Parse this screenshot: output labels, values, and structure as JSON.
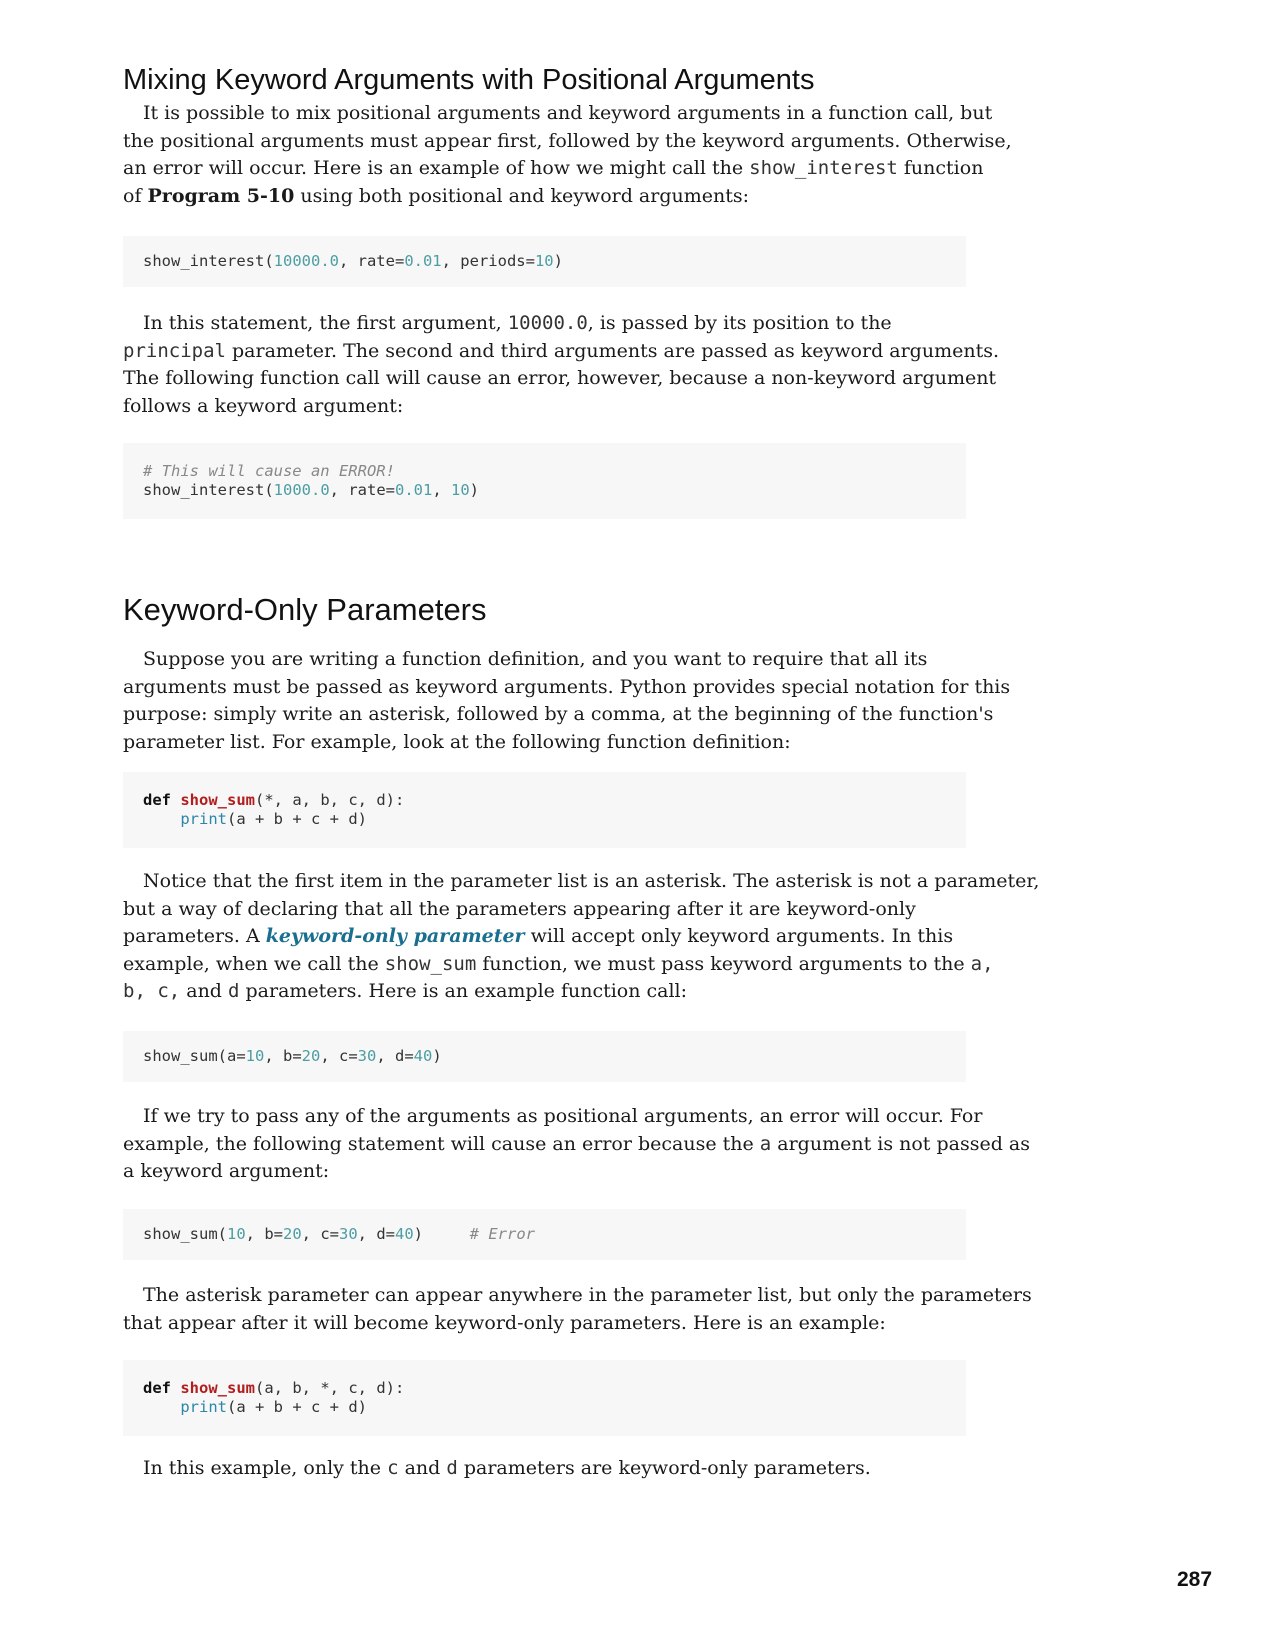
{
  "section1": {
    "heading": "Mixing Keyword Arguments with Positional Arguments",
    "p1": {
      "l1": "It is possible to mix positional arguments and keyword arguments in a function call, but",
      "l2": "the positional arguments must appear first, followed by the keyword arguments. Otherwise,",
      "l3a": "an error will occur. Here is an example of how we might call the ",
      "l3code": "show_interest",
      "l3b": " function",
      "l4a": "of ",
      "l4bold": "Program 5-10",
      "l4b": " using both positional and keyword arguments:"
    },
    "code1": {
      "a": "show_interest(",
      "n1": "10000.0",
      "b": ", rate=",
      "n2": "0.01",
      "c": ", periods=",
      "n3": "10",
      "d": ")"
    },
    "p2": {
      "l1a": "In this statement, the first argument, ",
      "l1code": "10000.0",
      "l1b": ", is passed by its position to the",
      "l2code": "principal",
      "l2b": " parameter. The second and third arguments are passed as keyword arguments.",
      "l3": "The following function call will cause an error, however, because a non-keyword argument",
      "l4": "follows a keyword argument:"
    },
    "code2": {
      "comment": "# This will cause an ERROR!",
      "a": "show_interest(",
      "n1": "1000.0",
      "b": ", rate=",
      "n2": "0.01",
      "c": ", ",
      "n3": "10",
      "d": ")"
    }
  },
  "section2": {
    "heading": "Keyword-Only Parameters",
    "p1": {
      "l1": "Suppose you are writing a function definition, and you want to require that all its",
      "l2": "arguments must be passed as keyword arguments. Python provides special notation for this",
      "l3": "purpose: simply write an asterisk, followed by a comma, at the beginning of the function's",
      "l4": "parameter list. For example, look at the following function definition:"
    },
    "code3": {
      "def": "def",
      "fn": "show_sum",
      "params": "(*, a, b, c, d):",
      "print": "print",
      "body": "(a + b + c + d)"
    },
    "p2": {
      "l1": "Notice that the first item in the parameter list is an asterisk. The asterisk is not a parameter,",
      "l2": "but a way of declaring that all the parameters appearing after it are keyword-only",
      "l3a": "parameters. A ",
      "l3term": "keyword-only parameter",
      "l3b": " will accept only keyword arguments. In this",
      "l4a": "example, when we call the ",
      "l4code": "show_sum",
      "l4b": " function, we must pass keyword arguments to the ",
      "l4code2": "a,",
      "l5code": "b, c,",
      "l5a": " and ",
      "l5code2": "d",
      "l5b": " parameters. Here is an example function call:"
    },
    "code4": {
      "a": "show_sum(a=",
      "n1": "10",
      "b": ", b=",
      "n2": "20",
      "c": ", c=",
      "n3": "30",
      "d": ", d=",
      "n4": "40",
      "e": ")"
    },
    "p3": {
      "l1": "If we try to pass any of the arguments as positional arguments, an error will occur. For",
      "l2a": "example, the following statement will cause an error because the ",
      "l2code": "a",
      "l2b": " argument is not passed as",
      "l3": "a keyword argument:"
    },
    "code5": {
      "a": "show_sum(",
      "n1": "10",
      "b": ", b=",
      "n2": "20",
      "c": ", c=",
      "n3": "30",
      "d": ", d=",
      "n4": "40",
      "e": ")     ",
      "comment": "# Error"
    },
    "p4": {
      "l1": "The asterisk parameter can appear anywhere in the parameter list, but only the parameters",
      "l2": "that appear after it will become keyword-only parameters. Here is an example:"
    },
    "code6": {
      "def": "def",
      "fn": "show_sum",
      "params": "(a, b, *, c, d):",
      "print": "print",
      "body": "(a + b + c + d)"
    },
    "p5": {
      "a": "In this example, only the ",
      "code1": "c",
      "b": " and ",
      "code2": "d",
      "c": " parameters are keyword-only parameters."
    }
  },
  "page_number": "287"
}
